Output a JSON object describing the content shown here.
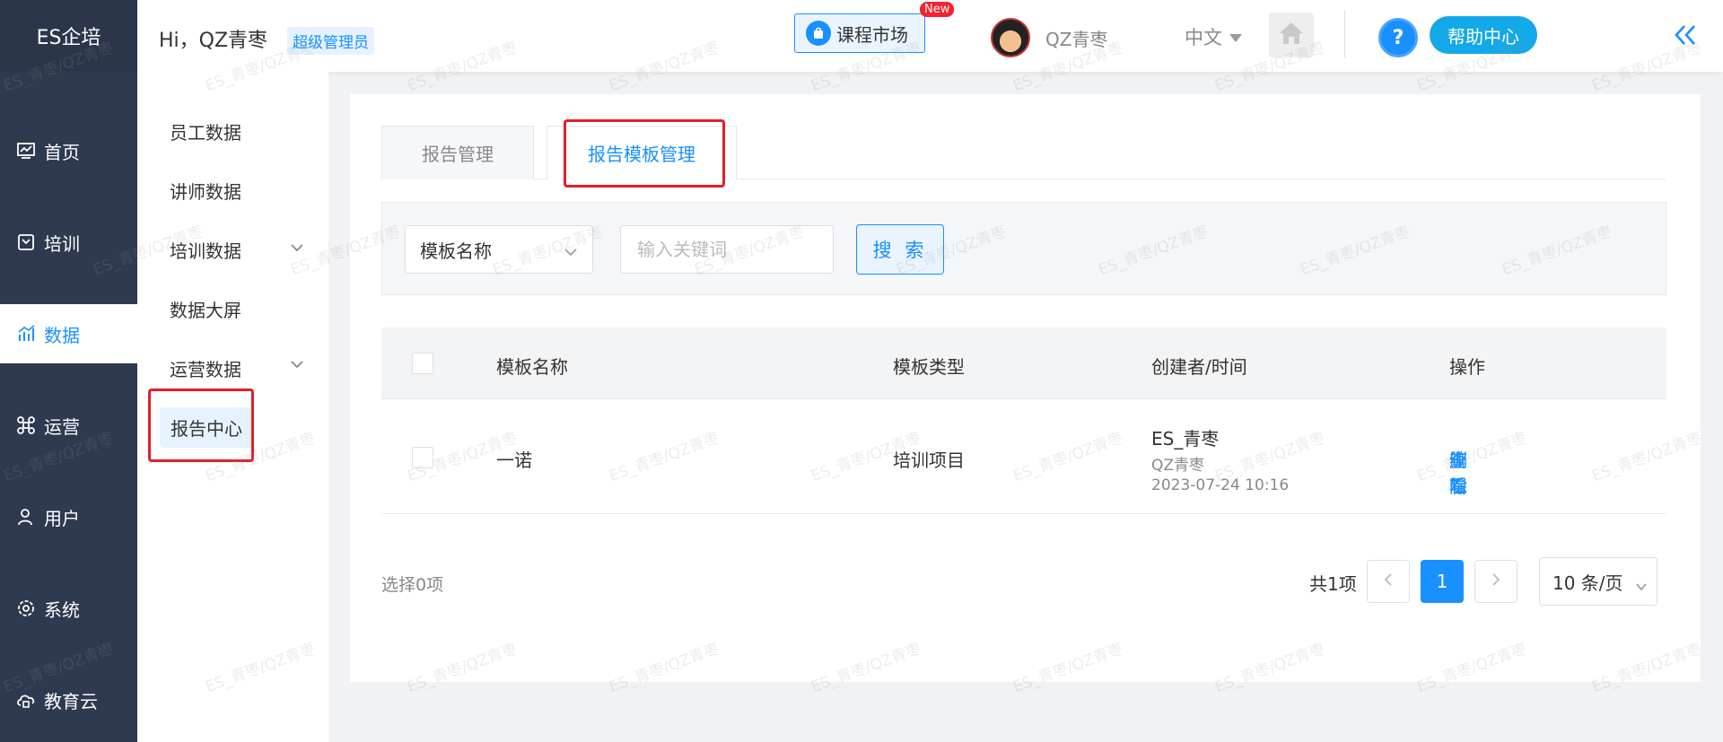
{
  "app": {
    "logo": "ES企培"
  },
  "sidebar": {
    "items": [
      {
        "label": "首页",
        "icon": "chart-monitor-icon"
      },
      {
        "label": "培训",
        "icon": "book-icon"
      },
      {
        "label": "数据",
        "icon": "bar-chart-icon",
        "active": true
      },
      {
        "label": "运营",
        "icon": "command-icon"
      },
      {
        "label": "用户",
        "icon": "user-icon"
      },
      {
        "label": "系统",
        "icon": "gear-icon"
      },
      {
        "label": "教育云",
        "icon": "cloud-icon"
      }
    ]
  },
  "header": {
    "greeting": "Hi，QZ青枣",
    "role": "超级管理员",
    "market": "课程市场",
    "new_badge": "New",
    "username": "QZ青枣",
    "language": "中文",
    "help": "帮助中心"
  },
  "submenu": {
    "items": [
      {
        "label": "员工数据"
      },
      {
        "label": "讲师数据"
      },
      {
        "label": "培训数据"
      },
      {
        "label": "数据大屏"
      },
      {
        "label": "运营数据"
      },
      {
        "label": "报告中心"
      }
    ]
  },
  "tabs": [
    {
      "label": "报告管理"
    },
    {
      "label": "报告模板管理"
    }
  ],
  "filter": {
    "select_value": "模板名称",
    "keyword_placeholder": "输入关键词",
    "search_label": "搜 索"
  },
  "table": {
    "columns": [
      "模板名称",
      "模板类型",
      "创建者/时间",
      "操作"
    ],
    "rows": [
      {
        "name": "一诺",
        "type": "培训项目",
        "creator": "ES_青枣",
        "creator_sub": "QZ青枣",
        "time": "2023-07-24 10:16",
        "actions": [
          "编辑",
          "查看",
          "删除"
        ]
      }
    ]
  },
  "footer": {
    "selected": "选择0项",
    "total": "共1项",
    "current_page": "1",
    "page_size": "10 条/页"
  },
  "watermark": "ES_青枣/QZ青枣",
  "colors": {
    "primary": "#1890ff",
    "sidebar": "#2e3a50",
    "highlight": "#e21f26"
  }
}
